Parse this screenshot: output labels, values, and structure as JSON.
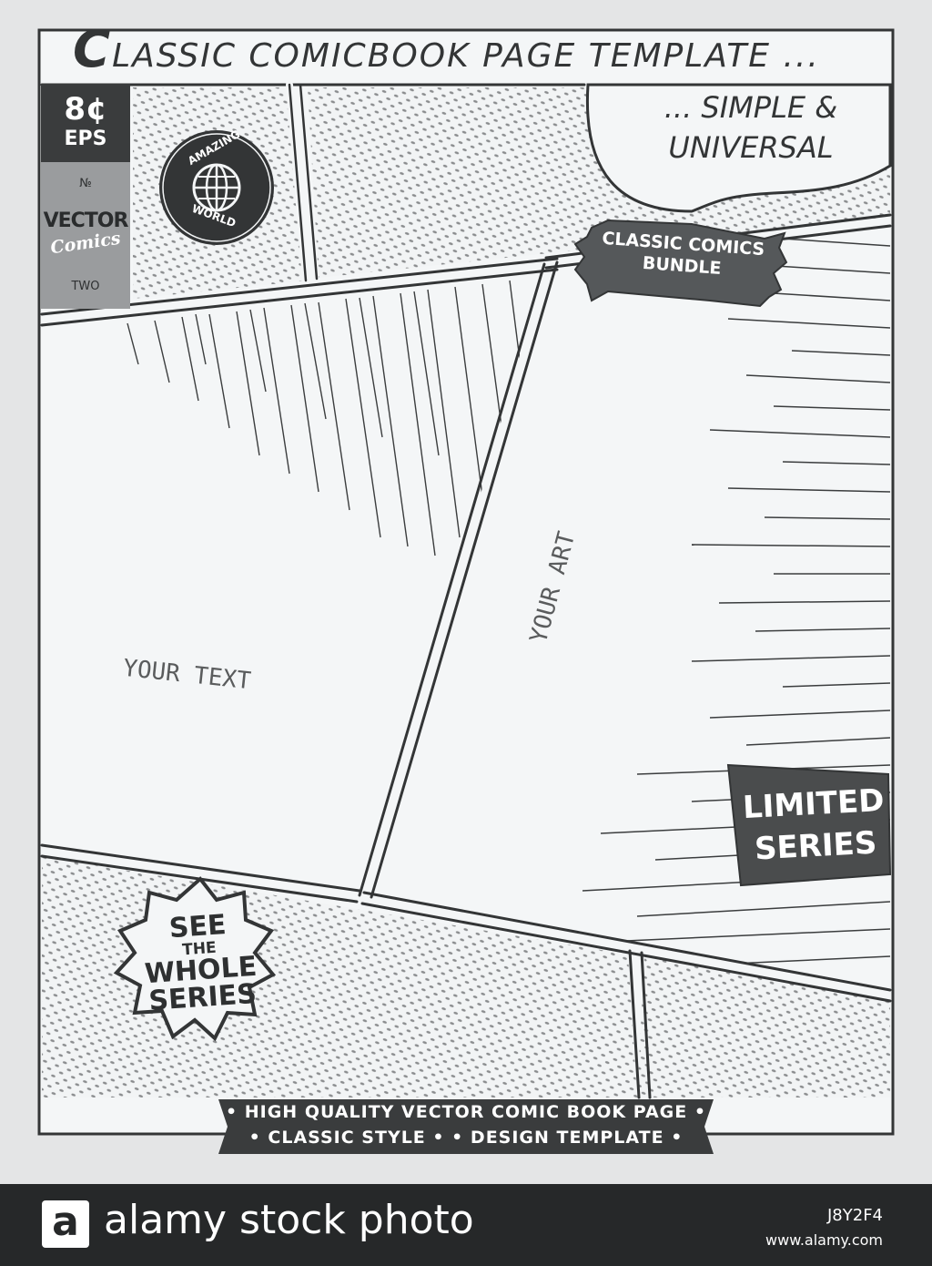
{
  "header": {
    "title_cap": "C",
    "title_rest": "LASSIC  COMICBOOK  PAGE  TEMPLATE ..."
  },
  "corner_box": {
    "price": "8¢",
    "format": "EPS",
    "number_symbol": "№",
    "brand_line1": "VECTOR",
    "brand_line2": "Comics",
    "issue": "TWO"
  },
  "globe_stamp": {
    "top_text": "AMAZING",
    "bottom_text": "WORLD",
    "icon": "globe-icon"
  },
  "speech_bubble": {
    "line1": "... SIMPLE &",
    "line2": "UNIVERSAL"
  },
  "bundle_badge": {
    "line1": "CLASSIC COMICS",
    "line2": "BUNDLE"
  },
  "panels": {
    "text_placeholder": "YOUR TEXT",
    "art_placeholder": "YOUR ART"
  },
  "limited_badge": {
    "line1": "LIMITED",
    "line2": "SERIES"
  },
  "see_series_badge": {
    "line1": "SEE",
    "line2": "THE",
    "line3": "WHOLE",
    "line4": "SERIES"
  },
  "bottom_banner": {
    "line1": "• HIGH QUALITY VECTOR COMIC BOOK PAGE •",
    "line2": "• CLASSIC   STYLE • • DESIGN TEMPLATE •"
  },
  "footer": {
    "logo_letter": "a",
    "site_name": "alamy stock photo",
    "image_id": "J8Y2F4",
    "site_url": "www.alamy.com"
  },
  "colors": {
    "ink": "#333536",
    "panel_bg": "#f4f6f7",
    "badge_dark": "#4a4c4d",
    "footer_bg": "#262829"
  }
}
